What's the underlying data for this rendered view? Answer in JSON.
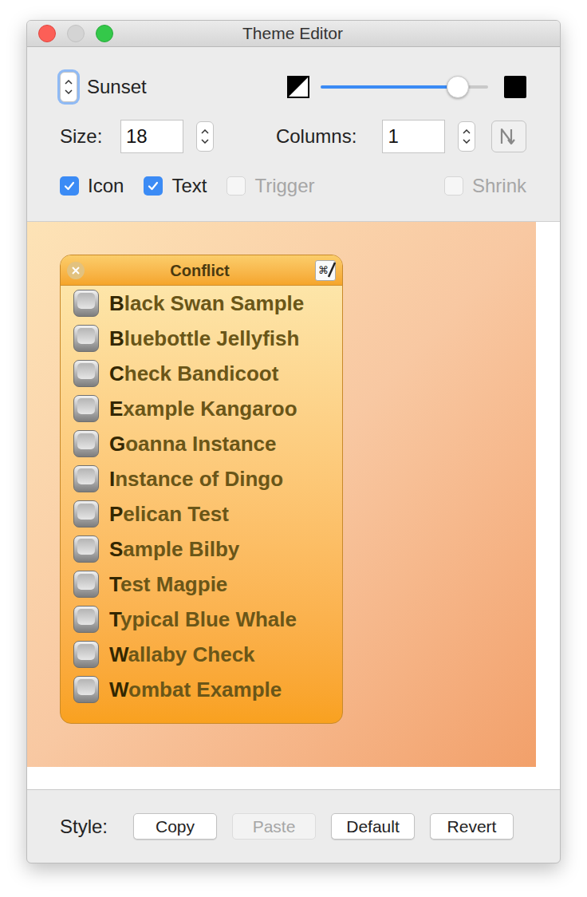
{
  "window": {
    "title": "Theme Editor"
  },
  "theme": {
    "name": "Sunset",
    "opacity": {
      "level": 0.82
    }
  },
  "size": {
    "label": "Size:",
    "value": "18"
  },
  "columns": {
    "label": "Columns:",
    "value": "1"
  },
  "options": [
    {
      "label": "Icon",
      "checked": true,
      "disabled": false
    },
    {
      "label": "Text",
      "checked": true,
      "disabled": false
    },
    {
      "label": "Trigger",
      "checked": false,
      "disabled": true
    },
    {
      "label": "Shrink",
      "checked": false,
      "disabled": true
    }
  ],
  "palette": {
    "title": "Conflict",
    "shortcut_glyph": "⌘",
    "items": [
      "Black Swan Sample",
      "Bluebottle Jellyfish",
      "Check Bandicoot",
      "Example Kangaroo",
      "Goanna Instance",
      "Instance of Dingo",
      "Pelican Test",
      "Sample Bilby",
      "Test Magpie",
      "Typical Blue Whale",
      "Wallaby Check",
      "Wombat Example"
    ]
  },
  "style": {
    "label": "Style:",
    "buttons": [
      {
        "label": "Copy",
        "disabled": false
      },
      {
        "label": "Paste",
        "disabled": true
      },
      {
        "label": "Default",
        "disabled": false
      },
      {
        "label": "Revert",
        "disabled": false
      }
    ]
  }
}
